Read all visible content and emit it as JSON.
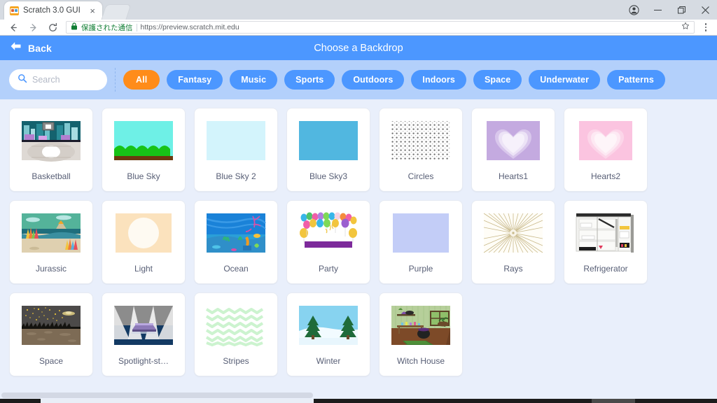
{
  "browser": {
    "tab": {
      "title": "Scratch 3.0 GUI",
      "close_label": "×",
      "favicon_name": "scratch-cat-favicon"
    },
    "window_controls": {
      "profile_label": "",
      "minimize_label": "",
      "maximize_label": "",
      "close_label": ""
    },
    "omnibox": {
      "secure_text": "保護された通信",
      "url": "https://preview.scratch.mit.edu"
    }
  },
  "modal": {
    "back_label": "Back",
    "title": "Choose a Backdrop"
  },
  "search": {
    "value": "",
    "placeholder": "Search"
  },
  "tags": [
    {
      "label": "All",
      "active": true
    },
    {
      "label": "Fantasy",
      "active": false
    },
    {
      "label": "Music",
      "active": false
    },
    {
      "label": "Sports",
      "active": false
    },
    {
      "label": "Outdoors",
      "active": false
    },
    {
      "label": "Indoors",
      "active": false
    },
    {
      "label": "Space",
      "active": false
    },
    {
      "label": "Underwater",
      "active": false
    },
    {
      "label": "Patterns",
      "active": false
    }
  ],
  "backdrops": [
    {
      "name": "Basketball",
      "thumb": "basketball"
    },
    {
      "name": "Blue Sky",
      "thumb": "blue-sky"
    },
    {
      "name": "Blue Sky 2",
      "thumb": "blue-sky-2"
    },
    {
      "name": "Blue Sky3",
      "thumb": "blue-sky-3"
    },
    {
      "name": "Circles",
      "thumb": "circles"
    },
    {
      "name": "Hearts1",
      "thumb": "hearts1"
    },
    {
      "name": "Hearts2",
      "thumb": "hearts2"
    },
    {
      "name": "Jurassic",
      "thumb": "jurassic"
    },
    {
      "name": "Light",
      "thumb": "light"
    },
    {
      "name": "Ocean",
      "thumb": "ocean"
    },
    {
      "name": "Party",
      "thumb": "party"
    },
    {
      "name": "Purple",
      "thumb": "purple"
    },
    {
      "name": "Rays",
      "thumb": "rays"
    },
    {
      "name": "Refrigerator",
      "thumb": "refrigerator"
    },
    {
      "name": "Space",
      "thumb": "space"
    },
    {
      "name": "Spotlight-st…",
      "thumb": "spotlight-stage"
    },
    {
      "name": "Stripes",
      "thumb": "stripes"
    },
    {
      "name": "Winter",
      "thumb": "winter"
    },
    {
      "name": "Witch House",
      "thumb": "witch-house"
    }
  ],
  "colors": {
    "header_blue": "#4c97ff",
    "filter_blue": "#b3d0fb",
    "active_orange": "#ff8c1a",
    "page_bg": "#e9effb",
    "label_gray": "#575e75"
  }
}
